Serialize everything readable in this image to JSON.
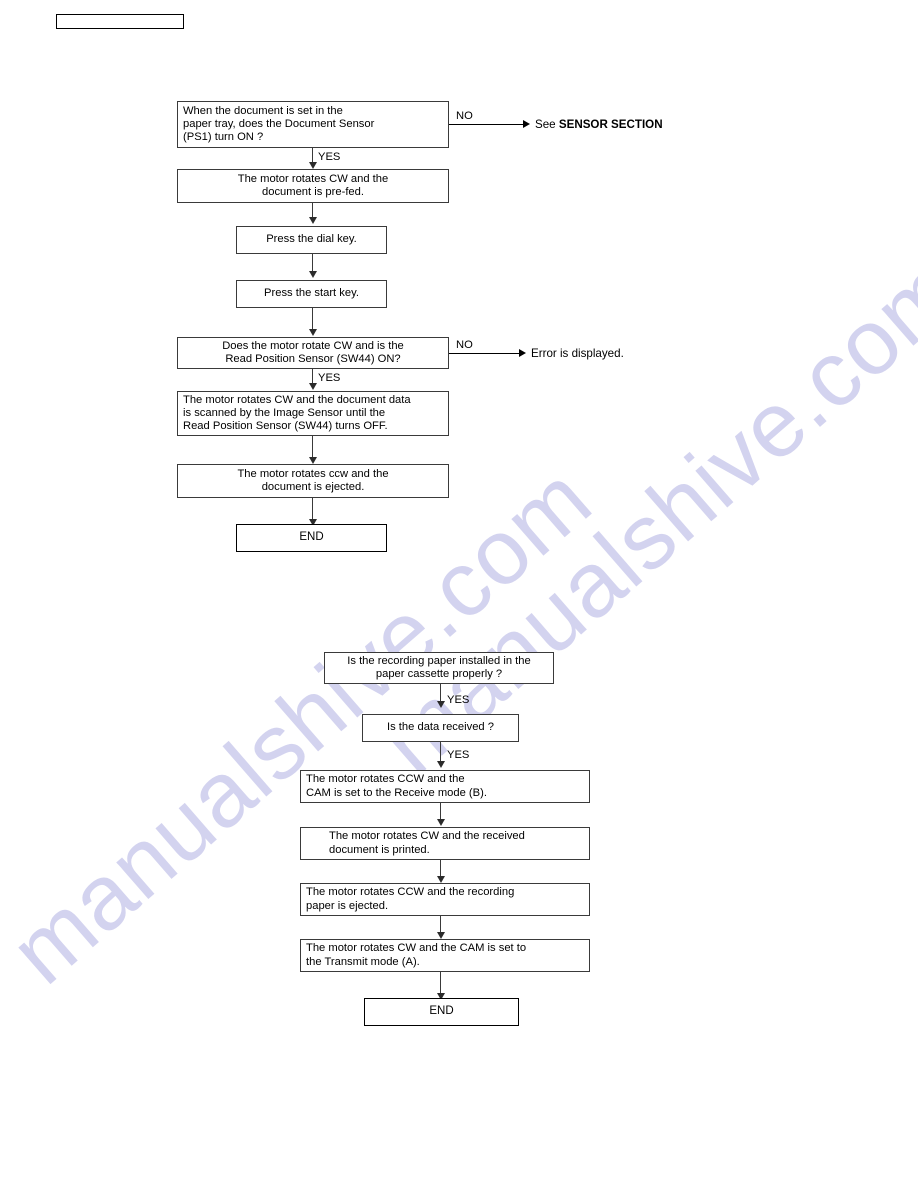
{
  "document": {
    "header_box_label": "",
    "watermark_text": "manualshive.com"
  },
  "flowcharts": [
    {
      "id": "document-transmit-flow",
      "nodes": [
        {
          "id": "fc1-n1",
          "lines": [
            "When the document is set in the",
            "paper tray, does the Document Sensor",
            "(PS1) turn ON ?"
          ]
        },
        {
          "id": "fc1-n2",
          "lines": [
            "The motor rotates CW and the",
            "document is pre-fed."
          ]
        },
        {
          "id": "fc1-n3",
          "lines": [
            "Press the dial key."
          ]
        },
        {
          "id": "fc1-n4",
          "lines": [
            "Press the start key."
          ]
        },
        {
          "id": "fc1-n5",
          "lines": [
            "Does the motor rotate CW and is the",
            "Read Position Sensor (SW44) ON?"
          ]
        },
        {
          "id": "fc1-n6",
          "lines": [
            "The motor rotates CW and the document data",
            "is scanned by the Image Sensor until the",
            "Read Position Sensor (SW44) turns OFF."
          ]
        },
        {
          "id": "fc1-n7",
          "lines": [
            "The motor rotates ccw and the",
            "document is ejected."
          ]
        },
        {
          "id": "fc1-end",
          "lines": [
            "END"
          ]
        }
      ],
      "edge_labels": {
        "yes_1": "YES",
        "no_1": "NO",
        "yes_2": "YES",
        "no_2": "NO"
      },
      "branch_targets": {
        "sensor_section_prefix": "See ",
        "sensor_section_bold": "SENSOR SECTION",
        "error_displayed": "Error is displayed."
      }
    },
    {
      "id": "recording-receive-flow",
      "nodes": [
        {
          "id": "fc2-n1",
          "lines": [
            "Is the recording paper installed in the",
            "paper cassette properly ?"
          ]
        },
        {
          "id": "fc2-n2",
          "lines": [
            "Is the data received ?"
          ]
        },
        {
          "id": "fc2-n3",
          "lines": [
            "The motor rotates CCW and the",
            "CAM is set to the Receive mode (B)."
          ]
        },
        {
          "id": "fc2-n4",
          "lines": [
            "The motor rotates CW and the received",
            "document is printed."
          ]
        },
        {
          "id": "fc2-n5",
          "lines": [
            "The motor rotates CCW and the recording",
            "paper is ejected."
          ]
        },
        {
          "id": "fc2-n6",
          "lines": [
            "The motor rotates CW and the CAM is set to",
            "the Transmit mode (A)."
          ]
        },
        {
          "id": "fc2-end",
          "lines": [
            "END"
          ]
        }
      ],
      "edge_labels": {
        "yes_1": "YES",
        "yes_2": "YES"
      }
    }
  ],
  "colors": {
    "line": "#3a3a3a",
    "text": "#000000",
    "watermark": "#d3d3ef",
    "background": "#ffffff"
  }
}
